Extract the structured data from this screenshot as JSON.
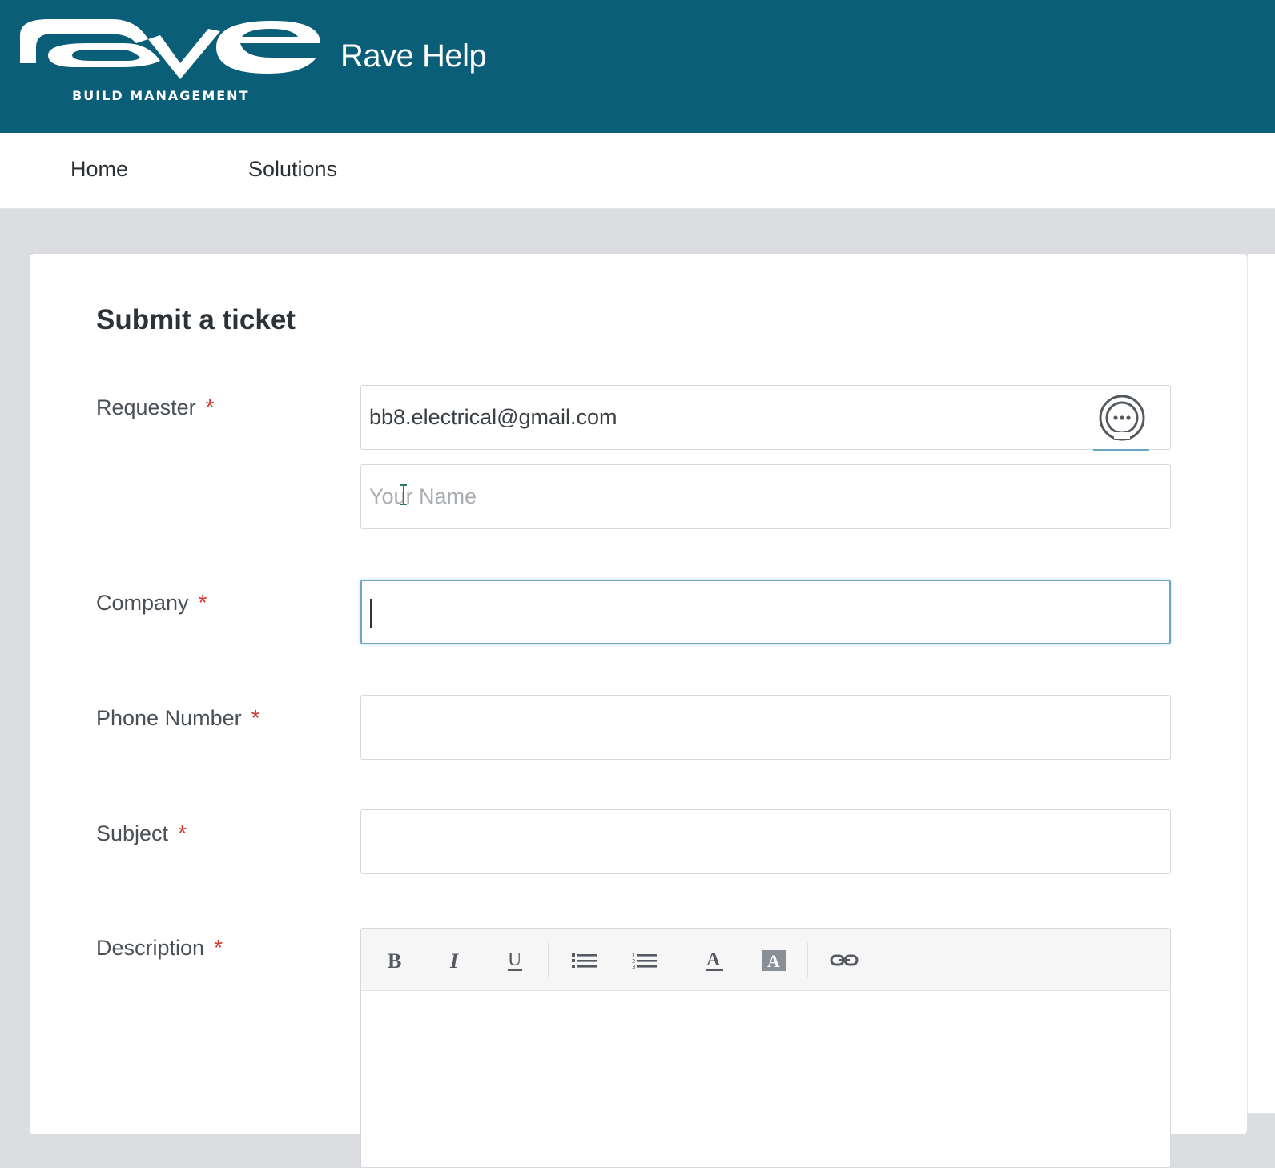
{
  "header": {
    "logo_subtext": "BUILD MANAGEMENT",
    "site_title": "Rave Help",
    "bg_color": "#0b5e78"
  },
  "nav": {
    "items": [
      {
        "label": "Home"
      },
      {
        "label": "Solutions"
      }
    ]
  },
  "form": {
    "title": "Submit a ticket",
    "required_marker": "*",
    "requester": {
      "label": "Requester",
      "email_value": "bb8.electrical@gmail.com",
      "name_placeholder": "Your Name"
    },
    "company": {
      "label": "Company",
      "value": ""
    },
    "phone": {
      "label": "Phone Number",
      "value": ""
    },
    "subject": {
      "label": "Subject",
      "value": ""
    },
    "description": {
      "label": "Description",
      "toolbar": [
        "bold-icon",
        "italic-icon",
        "underline-icon",
        "bulleted-list-icon",
        "numbered-list-icon",
        "font-color-icon",
        "background-color-icon",
        "link-icon"
      ]
    }
  },
  "colors": {
    "required": "#d0342c",
    "focus_border": "#6ba7c4"
  }
}
